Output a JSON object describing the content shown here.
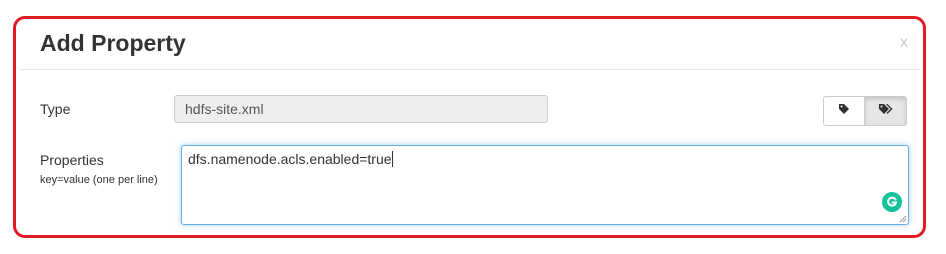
{
  "dialog": {
    "title": "Add Property",
    "close_label": "x"
  },
  "type_row": {
    "label": "Type",
    "value": "hdfs-site.xml"
  },
  "properties_row": {
    "label": "Properties",
    "hint": "key=value (one per line)",
    "value": "dfs.namenode.acls.enabled=true"
  },
  "toolbar": {
    "buttons": [
      "tag-icon",
      "tags-icon"
    ]
  },
  "colors": {
    "highlight": "#e21b23",
    "focus_border": "#66afe9",
    "grammarly": "#15c39a"
  }
}
